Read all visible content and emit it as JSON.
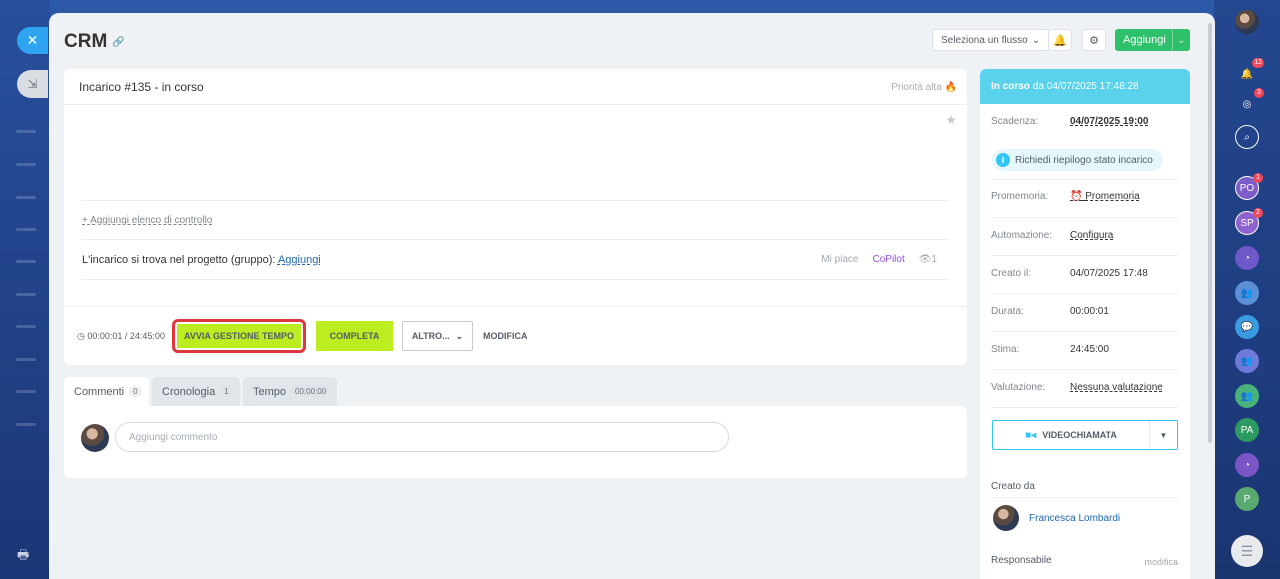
{
  "header": {
    "title": "CRM",
    "flow_select": "Seleziona un flusso",
    "add_label": "Aggiungi"
  },
  "task": {
    "title": "Incarico #135 - in corso",
    "priority": "Priorità alta",
    "add_checklist": "+ Aggiungi elenco di controllo",
    "project_text": "L'incarico si trova nel progetto (gruppo):",
    "project_link": "Aggiungi",
    "like": "Mi piace",
    "copilot": "CoPilot",
    "views": "1",
    "timer": "00:00:01 / 24:45:00",
    "btn_start_time": "AVVIA GESTIONE TEMPO",
    "btn_complete": "COMPLETA",
    "btn_more": "ALTRO...",
    "btn_edit": "MODIFICA"
  },
  "tabs": [
    {
      "label": "Commenti",
      "count": "0"
    },
    {
      "label": "Cronologia",
      "count": "1"
    },
    {
      "label": "Tempo",
      "count": "00:00:00"
    }
  ],
  "comments": {
    "placeholder": "Aggiungi commento"
  },
  "details": {
    "status_bold": "In corso",
    "status_rest": "da 04/07/2025 17:48:28",
    "deadline_label": "Scadenza:",
    "deadline_value": "04/07/2025 19:00",
    "summary_request": "Richiedi riepilogo stato incarico",
    "reminder_label": "Promemoria:",
    "reminder_value": "Promemoria",
    "automation_label": "Automazione:",
    "automation_value": "Configura",
    "created_label": "Creato il:",
    "created_value": "04/07/2025 17:48",
    "duration_label": "Durata:",
    "duration_value": "00:00:01",
    "estimate_label": "Stima:",
    "estimate_value": "24:45:00",
    "rating_label": "Valutazione:",
    "rating_value": "Nessuna valutazione",
    "video_call": "VIDEOCHIAMATA",
    "created_by_label": "Creato da",
    "creator_name": "Francesca Lombardi",
    "responsible_label": "Responsabile",
    "responsible_edit": "modifica"
  },
  "right_bar": {
    "notifications_badge": "12",
    "activity_badge": "3",
    "po_label": "PO",
    "po_badge": "1",
    "sp_label": "SP",
    "sp_badge": "2",
    "pa_label": "PA",
    "p_label": "P"
  },
  "colors": {
    "accent_green": "#bbed21",
    "highlight_red": "#e0353f",
    "status_cyan": "#5bd2ec",
    "add_green": "#2fc06b"
  }
}
